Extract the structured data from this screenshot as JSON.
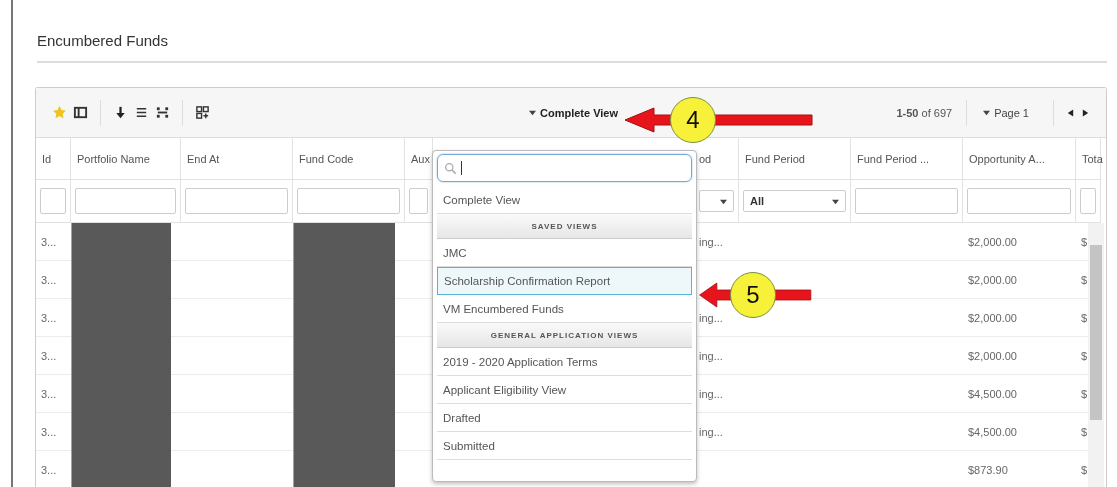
{
  "page_title": "Encumbered Funds",
  "view_selector": {
    "label": "Complete View",
    "expanded": true
  },
  "pager": {
    "range": "**1-50** of 697",
    "page": "Page 1"
  },
  "columns": [
    {
      "header": "Id",
      "kind": "normal",
      "filter": {
        "kind": "text"
      }
    },
    {
      "header": "Portfolio Name",
      "kind": "normal",
      "filter": {
        "kind": "text"
      },
      "redacted": true
    },
    {
      "header": "End At",
      "kind": "normal",
      "filter": {
        "kind": "text"
      }
    },
    {
      "header": "Fund Code",
      "kind": "normal",
      "filter": {
        "kind": "text"
      },
      "redacted": true
    },
    {
      "header": "Aux",
      "kind": "normal",
      "filter": {
        "kind": "text"
      }
    },
    {
      "header": "od",
      "kind": "partly-hidden",
      "filter": {
        "kind": "select"
      }
    },
    {
      "header": "Fund Period",
      "kind": "normal",
      "filter": {
        "kind": "select",
        "value": "All"
      }
    },
    {
      "header": "Fund Period ...",
      "kind": "normal",
      "filter": {
        "kind": "text"
      }
    },
    {
      "header": "Opportunity A...",
      "kind": "normal",
      "filter": {
        "kind": "text"
      }
    },
    {
      "header": "Tota",
      "kind": "normal",
      "filter": {
        "kind": "text"
      }
    }
  ],
  "rows": [
    {
      "cells": [
        "3...",
        "",
        "",
        "",
        "",
        "ing...",
        "",
        "",
        "$2,000.00",
        "$"
      ]
    },
    {
      "cells": [
        "3...",
        "",
        "",
        "",
        "",
        "",
        "",
        "",
        "$2,000.00",
        "$"
      ]
    },
    {
      "cells": [
        "3...",
        "",
        "",
        "",
        "",
        "ing...",
        "",
        "",
        "$2,000.00",
        "$"
      ]
    },
    {
      "cells": [
        "3...",
        "",
        "",
        "",
        "",
        "ing...",
        "",
        "",
        "$2,000.00",
        "$"
      ]
    },
    {
      "cells": [
        "3...",
        "",
        "",
        "",
        "",
        "ing...",
        "",
        "",
        "$4,500.00",
        "$"
      ]
    },
    {
      "cells": [
        "3...",
        "",
        "",
        "",
        "",
        "ing...",
        "",
        "",
        "$4,500.00",
        "$"
      ]
    },
    {
      "cells": [
        "3...",
        "",
        "",
        "",
        "",
        "",
        "",
        "",
        "$873.90",
        "$"
      ]
    }
  ],
  "menu": {
    "items": [
      {
        "kind": "option",
        "label": "Complete View",
        "selected": false
      },
      {
        "kind": "group",
        "label": "SAVED VIEWS"
      },
      {
        "kind": "option",
        "label": "JMC",
        "selected": false
      },
      {
        "kind": "option",
        "label": "Scholarship Confirmation Report",
        "selected": true
      },
      {
        "kind": "option",
        "label": "VM Encumbered Funds",
        "selected": false
      },
      {
        "kind": "group",
        "label": "GENERAL APPLICATION VIEWS"
      },
      {
        "kind": "option",
        "label": "2019 - 2020 Application Terms",
        "selected": false
      },
      {
        "kind": "option",
        "label": "Applicant Eligibility View",
        "selected": false
      },
      {
        "kind": "option",
        "label": "Drafted",
        "selected": false
      },
      {
        "kind": "option",
        "label": "Submitted",
        "selected": false
      }
    ]
  },
  "callouts": [
    {
      "label": "4"
    },
    {
      "label": "5"
    }
  ]
}
